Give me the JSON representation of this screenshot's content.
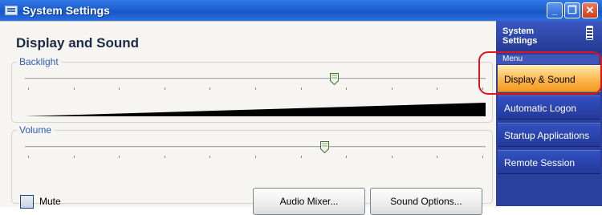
{
  "window": {
    "title": "System Settings",
    "controls": {
      "minimize": "_",
      "restore": "❐",
      "close": "✕"
    }
  },
  "page": {
    "title": "Display and Sound"
  },
  "backlight": {
    "label": "Backlight",
    "level_percent": 67
  },
  "volume": {
    "label": "Volume",
    "level_percent": 65,
    "mute_label": "Mute",
    "mute_checked": false
  },
  "buttons": {
    "audio_mixer": "Audio Mixer...",
    "sound_options": "Sound Options..."
  },
  "sidepanel": {
    "title": "System Settings",
    "menu_caption": "Menu",
    "items": [
      {
        "label": "Display & Sound",
        "active": true
      },
      {
        "label": "Automatic Logon",
        "active": false
      },
      {
        "label": "Startup Applications",
        "active": false
      },
      {
        "label": "Remote Session",
        "active": false
      }
    ]
  },
  "colors": {
    "titlebar": "#2362d6",
    "menu_bg": "#2b3f9c",
    "menu_active": "#f7a936",
    "group_label": "#2e5dc1",
    "highlight": "#e3131a"
  },
  "icons": [
    "app-icon",
    "minimize-icon",
    "restore-icon",
    "close-icon",
    "battery-icon",
    "slider-thumb"
  ]
}
